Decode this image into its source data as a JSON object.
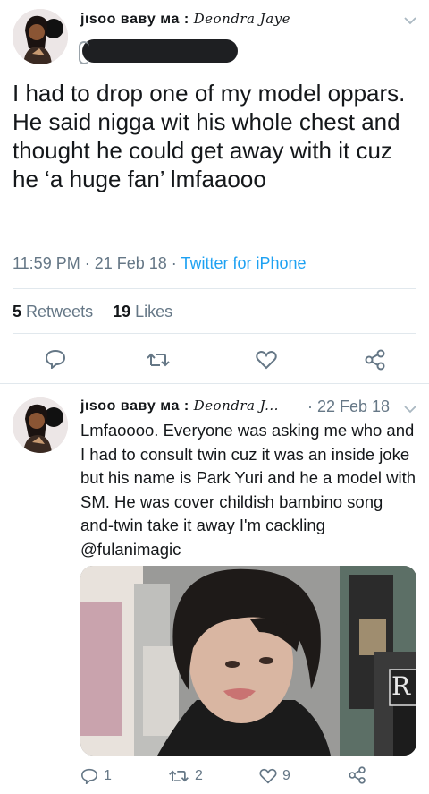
{
  "main_tweet": {
    "display_name_plain": "jιsoo вaвy мa : ",
    "display_name_script": "Deondra Jaye",
    "text": "I had to drop one of my model oppars. He said nigga wit his whole chest and thought he could get away with it cuz he ‘a huge fan’ lmfaaooo",
    "time": "11:59 PM",
    "sep1": " · ",
    "date": "21 Feb 18",
    "sep2": " · ",
    "source": "Twitter for iPhone",
    "retweets_count": "5",
    "retweets_label": "Retweets",
    "likes_count": "19",
    "likes_label": "Likes"
  },
  "reply_tweet": {
    "display_name_plain": "jιsoo вaвy мa : ",
    "display_name_script": "Deondra J...",
    "date": "· 22 Feb 18",
    "text": "Lmfaoooo. Everyone was asking me who and I had to consult twin cuz it was an inside joke but his name is Park Yuri and he a model with SM. He was cover childish bambino song and-twin take it away I'm cackling @fulanimagic",
    "reply_count": "1",
    "retweet_count": "2",
    "like_count": "9",
    "media_sign_letter": "R"
  },
  "colors": {
    "accent": "#1da1f2",
    "gray": "#657786",
    "divider": "#e1e8ed",
    "redacted": "#1e1f22"
  },
  "icons": [
    "chevron-down-icon",
    "reply-icon",
    "retweet-icon",
    "like-icon",
    "share-icon"
  ]
}
